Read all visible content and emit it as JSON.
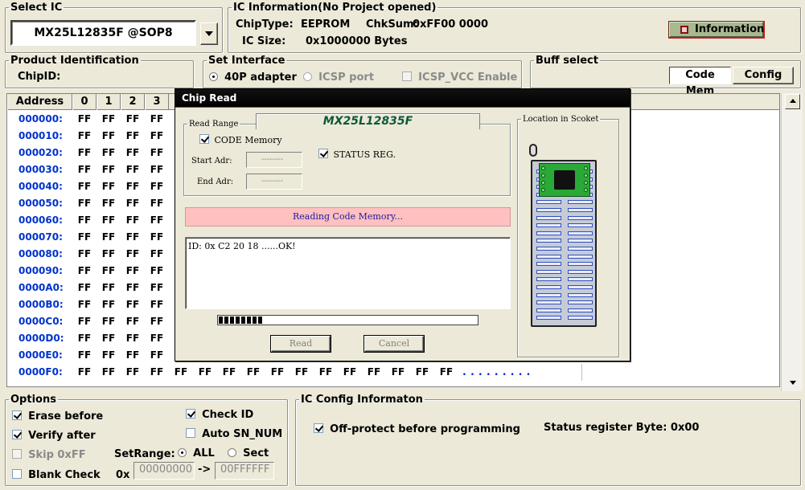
{
  "select_ic": {
    "legend": "Select IC",
    "device": "MX25L12835F @SOP8"
  },
  "ic_info": {
    "legend": "IC Information(No Project opened)",
    "chip_type_label": "ChipType:",
    "chip_type_value": "EEPROM",
    "chksum_label": "ChkSum:",
    "chksum_value": "0xFF00 0000",
    "ic_size_label": "IC Size:",
    "ic_size_value": "0x1000000 Bytes",
    "info_button": "Information"
  },
  "product_id": {
    "legend": "Product Identification",
    "chip_id_label": "ChipID:"
  },
  "set_interface": {
    "legend": "Set Interface",
    "option1": "40P adapter",
    "option2": "ICSP port",
    "option3": "ICSP_VCC Enable"
  },
  "buff_select": {
    "legend": "Buff select",
    "code_mem": "Code Mem",
    "config": "Config"
  },
  "grid": {
    "address_header": "Address",
    "col_headers": [
      "0",
      "1",
      "2",
      "3"
    ],
    "addresses": [
      "000000:",
      "000010:",
      "000020:",
      "000030:",
      "000040:",
      "000050:",
      "000060:",
      "000070:",
      "000080:",
      "000090:",
      "0000A0:",
      "0000B0:",
      "0000C0:",
      "0000D0:",
      "0000E0:",
      "0000F0:"
    ],
    "cell_value": "FF",
    "trail_dots": "........."
  },
  "dialog": {
    "title": "Chip Read",
    "read_range_legend": "Read Range",
    "chip_name": "MX25L12835F",
    "code_memory": "CODE Memory",
    "status_reg": "STATUS REG.",
    "start_adr_label": "Start Adr:",
    "end_adr_label": "End Adr:",
    "start_adr_value": "--------",
    "end_adr_value": "--------",
    "status_text": "Reading Code Memory...",
    "log_text": "ID: 0x C2 20 18 ......OK!",
    "progress_fraction": 0.18,
    "read_button": "Read",
    "cancel_button": "Cancel",
    "location_legend": "Location in Scoket"
  },
  "options": {
    "legend": "Options",
    "erase_before": "Erase before",
    "verify_after": "Verify after",
    "skip_ff": "Skip 0xFF",
    "blank_check": "Blank Check",
    "check_id": "Check ID",
    "auto_sn": "Auto SN_NUM",
    "set_range_label": "SetRange:",
    "range_all": "ALL",
    "range_sect": "Sect",
    "hex_prefix": "0x",
    "range_start": "00000000",
    "arrow": "->",
    "range_end": "00FFFFFF"
  },
  "ic_config": {
    "legend": "IC Config Informaton",
    "off_protect": "Off-protect before programming",
    "status_reg_byte": "Status register Byte: 0x00"
  },
  "colors": {
    "address_blue": "#0033cc",
    "status_pink": "#ffc0c0",
    "chip_name_green": "#0a5a3a"
  }
}
